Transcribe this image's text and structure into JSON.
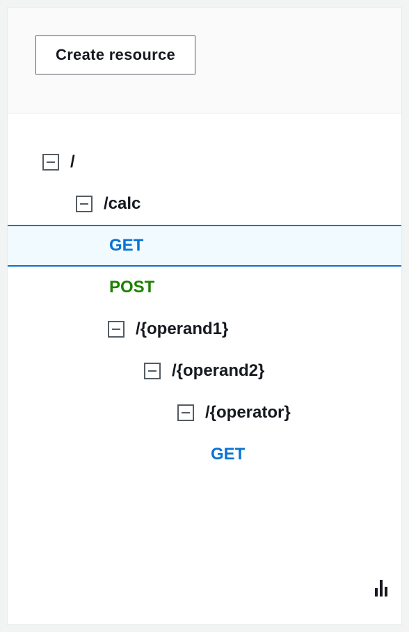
{
  "toolbar": {
    "create_resource_label": "Create resource"
  },
  "tree": {
    "root": {
      "label": "/"
    },
    "calc": {
      "label": "/calc"
    },
    "calc_get": {
      "label": "GET"
    },
    "calc_post": {
      "label": "POST"
    },
    "operand1": {
      "label": "/{operand1}"
    },
    "operand2": {
      "label": "/{operand2}"
    },
    "operator": {
      "label": "/{operator}"
    },
    "operator_get": {
      "label": "GET"
    }
  }
}
